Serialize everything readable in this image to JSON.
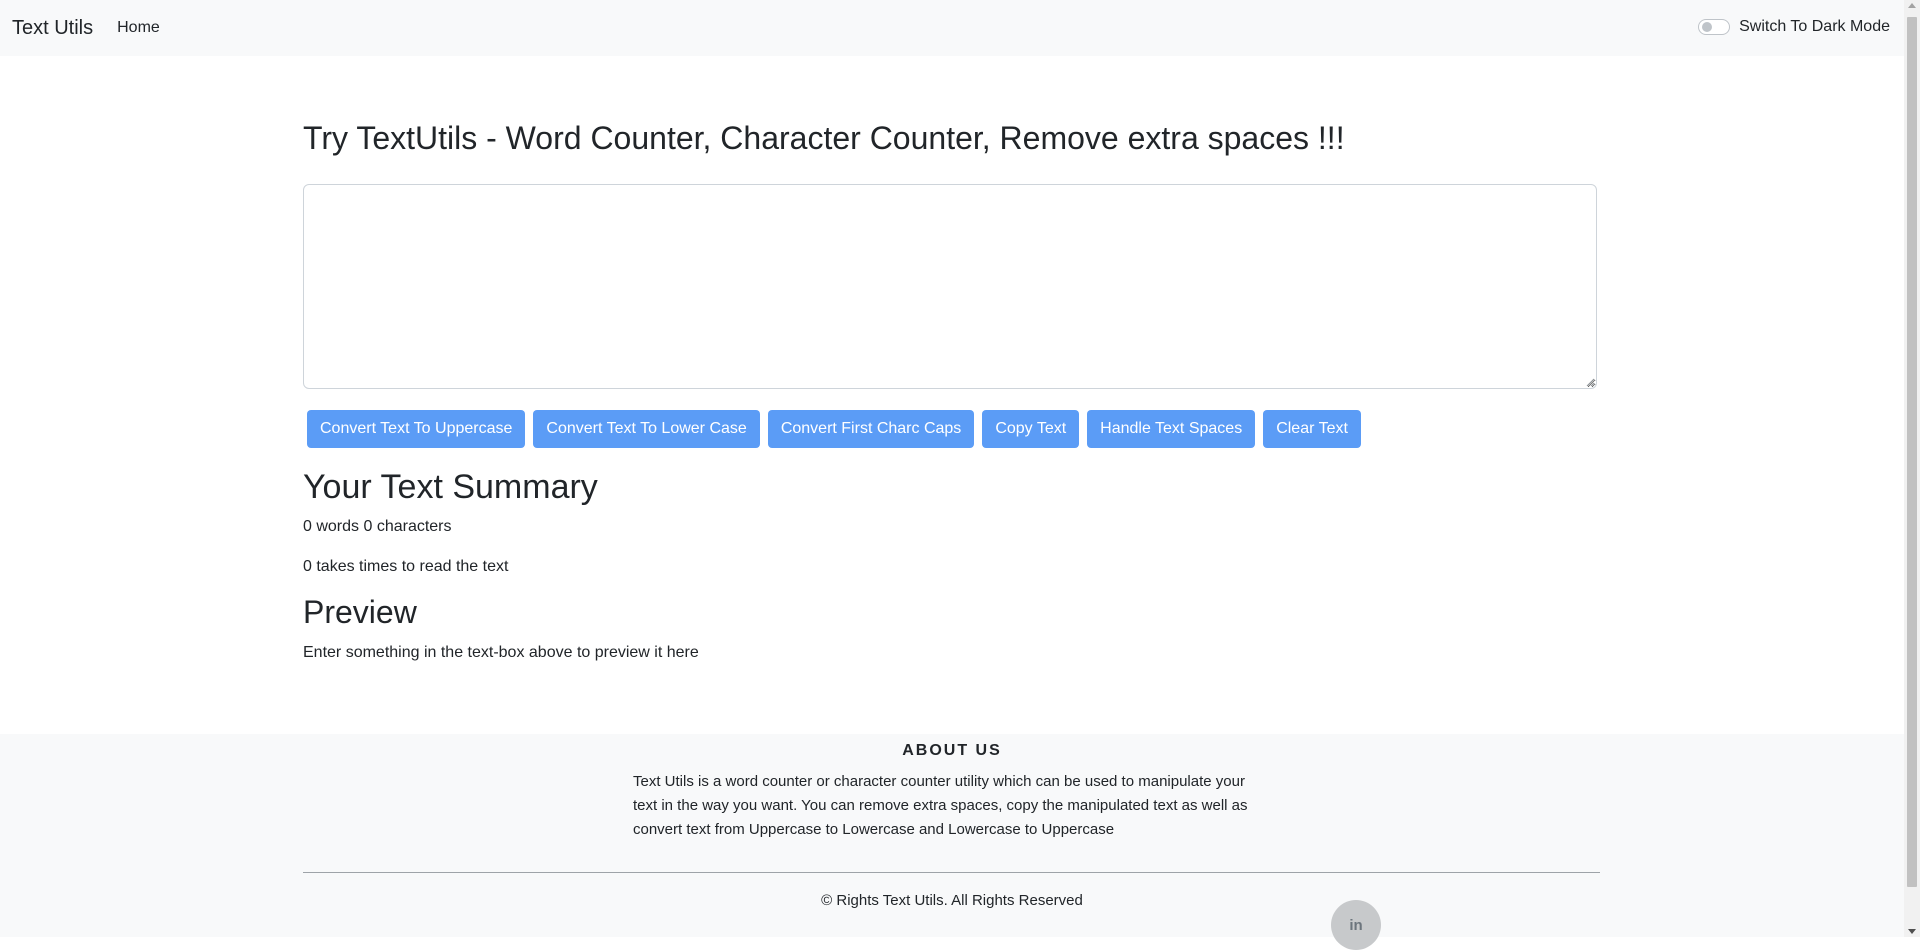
{
  "navbar": {
    "brand": "Text Utils",
    "home_label": "Home",
    "dark_mode_label": "Switch To Dark Mode"
  },
  "main": {
    "heading": "Try TextUtils - Word Counter, Character Counter, Remove extra spaces !!!",
    "textarea_value": "",
    "buttons": [
      "Convert Text To Uppercase",
      "Convert Text To Lower Case",
      "Convert First Charc Caps",
      "Copy Text",
      "Handle Text Spaces",
      "Clear Text"
    ],
    "summary_title": "Your Text Summary",
    "summary_line": "0 words 0 characters",
    "read_time_line": "0 takes times to read the text",
    "preview_title": "Preview",
    "preview_text": "Enter something in the text-box above to preview it here"
  },
  "footer": {
    "about_title": "ABOUT US",
    "about_text": "Text Utils is a word counter or character counter utility which can be used to manipulate your text in the way you want. You can remove extra spaces, copy the manipulated text as well as convert text from Uppercase to Lowercase and Lowercase to Uppercase",
    "copyright": "© Rights Text Utils. All Rights Reserved",
    "linkedin_label": "in"
  },
  "colors": {
    "button_bg": "#5b9cf6",
    "navbar_bg": "#f8f9fa"
  }
}
